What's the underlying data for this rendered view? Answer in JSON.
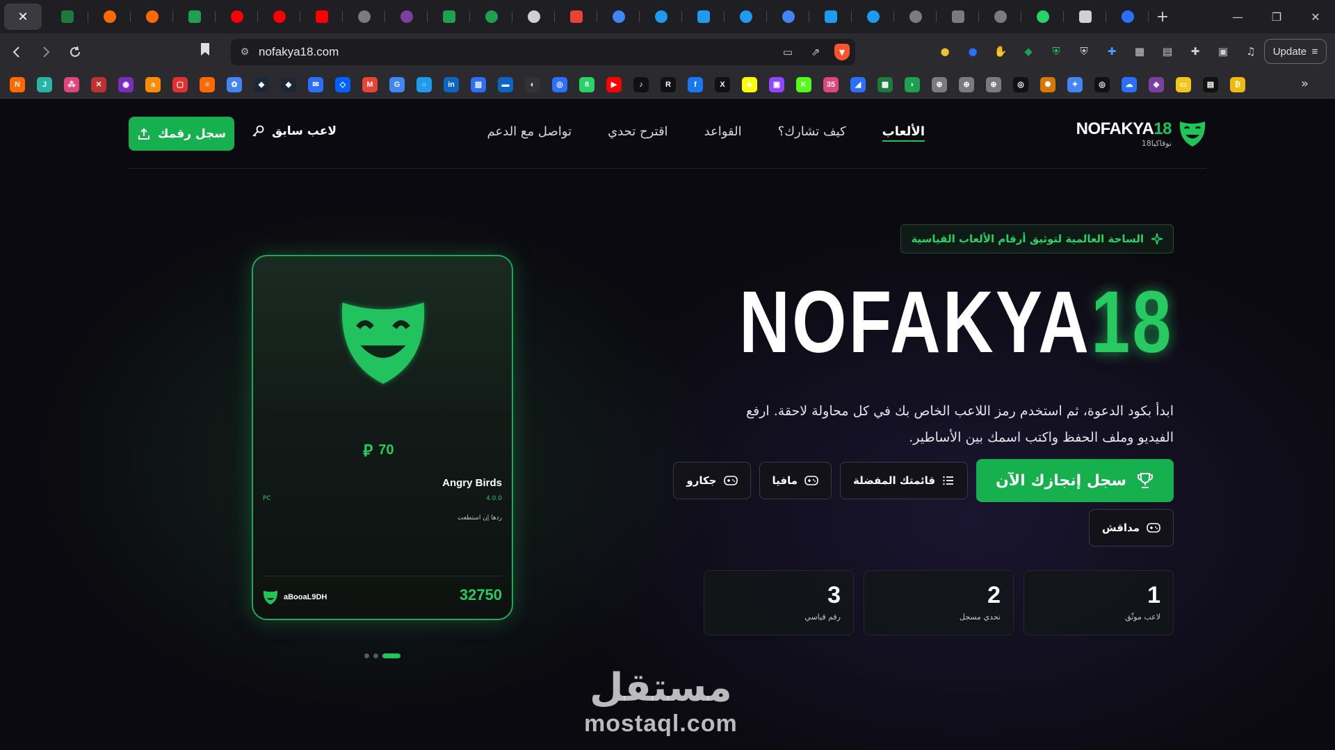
{
  "browser": {
    "tab_close_label": "✕",
    "new_tab_label": "+",
    "window_controls": {
      "minimize": "—",
      "restore": "❐",
      "close": "✕"
    },
    "url": "nofakya18.com",
    "update_label": "Update",
    "more_bookmarks": "»",
    "tab_favicon_colors": [
      "#1c7a3c",
      "#ff6a00",
      "#ff6a00",
      "#1fa050",
      "#ff0000",
      "#ff0000",
      "#ff0000",
      "#7a7a80",
      "#7b3fa0",
      "#1fa050",
      "#1fa050",
      "#d0d0d4",
      "#ea4335",
      "#4285f4",
      "#1d9bf0",
      "#1d9bf0",
      "#1d9bf0",
      "#4285f4",
      "#1d9bf0",
      "#1d9bf0",
      "#7a7a80",
      "#7a7a80",
      "#7a7a80",
      "#25d366",
      "#d0d0d4",
      "#2b6fff"
    ],
    "bookmark_items": [
      {
        "t": "N",
        "c": "#ff6a00"
      },
      {
        "t": "J",
        "c": "#27b5a5"
      },
      {
        "t": "⁂",
        "c": "#e0457b"
      },
      {
        "t": "✕",
        "c": "#c03030"
      },
      {
        "t": "◉",
        "c": "#7b2cbf"
      },
      {
        "t": "a",
        "c": "#ff8c00"
      },
      {
        "t": "▢",
        "c": "#e03030"
      },
      {
        "t": "≡",
        "c": "#ff6a00"
      },
      {
        "t": "✿",
        "c": "#4285f4"
      },
      {
        "t": "◆",
        "c": "#1b2838"
      },
      {
        "t": "◆",
        "c": "#1b2838"
      },
      {
        "t": "✉",
        "c": "#2b6fff"
      },
      {
        "t": "◇",
        "c": "#0061ff"
      },
      {
        "t": "M",
        "c": "#ea4335"
      },
      {
        "t": "G",
        "c": "#4285f4"
      },
      {
        "t": "○",
        "c": "#1d9bf0"
      },
      {
        "t": "in",
        "c": "#0a66c2"
      },
      {
        "t": "▥",
        "c": "#2b6fff"
      },
      {
        "t": "▬",
        "c": "#0a66c2"
      },
      {
        "t": "◐",
        "c": "#333"
      },
      {
        "t": "◎",
        "c": "#2b6fff"
      },
      {
        "t": "8",
        "c": "#25d366"
      },
      {
        "t": "▶",
        "c": "#ff0000"
      },
      {
        "t": "♪",
        "c": "#111"
      },
      {
        "t": "R",
        "c": "#111"
      },
      {
        "t": "f",
        "c": "#1877f2"
      },
      {
        "t": "X",
        "c": "#111"
      },
      {
        "t": "☻",
        "c": "#fffc00"
      },
      {
        "t": "▣",
        "c": "#9146ff"
      },
      {
        "t": "K",
        "c": "#53fc18"
      },
      {
        "t": "35",
        "c": "#e0457b"
      },
      {
        "t": "◢",
        "c": "#2b6fff"
      },
      {
        "t": "▦",
        "c": "#1c7a3c"
      },
      {
        "t": "◗",
        "c": "#1fa050"
      },
      {
        "t": "⊕",
        "c": "#7a7a80"
      },
      {
        "t": "⊕",
        "c": "#7a7a80"
      },
      {
        "t": "⊕",
        "c": "#7a7a80"
      },
      {
        "t": "◎",
        "c": "#111"
      },
      {
        "t": "✺",
        "c": "#d97706"
      },
      {
        "t": "✦",
        "c": "#4285f4"
      },
      {
        "t": "◎",
        "c": "#111"
      },
      {
        "t": "☁",
        "c": "#2b6fff"
      },
      {
        "t": "◈",
        "c": "#7b3fa0"
      },
      {
        "t": "▭",
        "c": "#f5c518"
      },
      {
        "t": "▤",
        "c": "#111"
      },
      {
        "t": "₿",
        "c": "#f0b90b"
      }
    ]
  },
  "nav": {
    "brand_name": "NOFAKYA",
    "brand_num": "18",
    "brand_sub": "نوفاكيا18",
    "links": [
      "الألعاب",
      "كيف تشارك؟",
      "القواعد",
      "اقترح تحدي",
      "تواصل مع الدعم"
    ],
    "prev_player": "لاعب سابق",
    "register": "سجل رقمك"
  },
  "hero": {
    "tagline": "الساحة العالمية لتوثيق أرقام الألعاب القياسية",
    "title_white": "NOFAKYA",
    "title_green": "18",
    "description": "ابدأ بكود الدعوة، ثم استخدم رمز اللاعب الخاص بك في كل محاولة لاحقة. ارفع الفيديو وملف الحفظ واكتب اسمك بين الأساطير.",
    "cta": "سجل إنجازك الآن",
    "buttons": [
      "قائمتك المفضلة",
      "مافيا",
      "جكارو"
    ],
    "button_2nd_row": "مداقش"
  },
  "stats": [
    {
      "num": "1",
      "label": "لاعب موثّق"
    },
    {
      "num": "2",
      "label": "تحدي مسجل"
    },
    {
      "num": "3",
      "label": "رقم قياسي"
    }
  ],
  "card": {
    "price": "70",
    "title": "Angry Birds",
    "platform": "PC",
    "version": "4.0.0",
    "note": "ردها إن استطعت",
    "user": "aBooaL9DH",
    "score": "32750"
  },
  "watermark": {
    "ar": "مستقل",
    "en": "mostaql.com"
  },
  "colors": {
    "accent": "#17b04f",
    "accent_bright": "#27c961",
    "bg": "#0b0a10"
  }
}
